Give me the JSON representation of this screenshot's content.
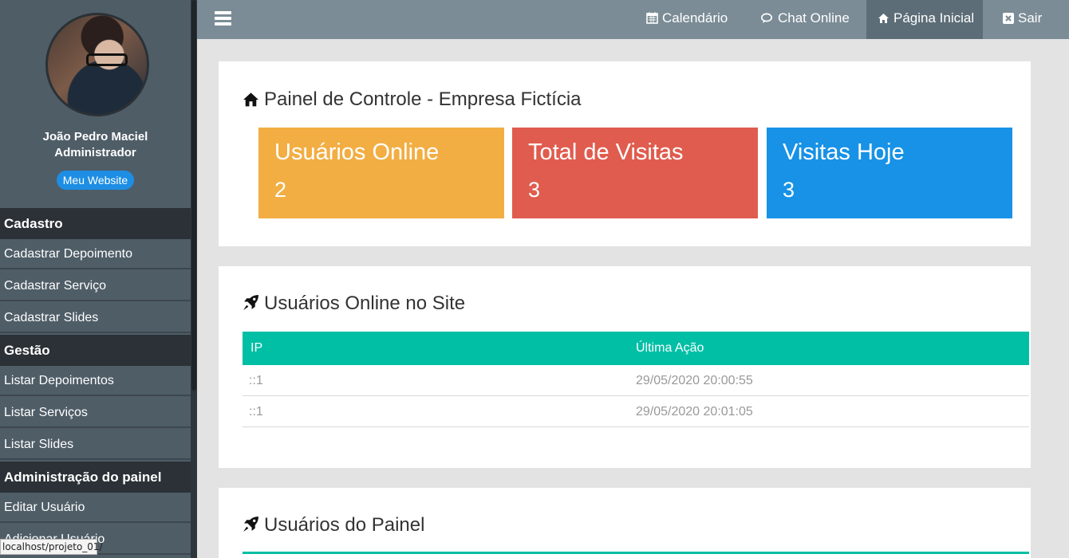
{
  "sidebar": {
    "user_name": "João Pedro Maciel",
    "user_role": "Administrador",
    "website_button": "Meu Website",
    "sections": [
      {
        "title": "Cadastro",
        "items": [
          "Cadastrar Depoimento",
          "Cadastrar Serviço",
          "Cadastrar Slides"
        ]
      },
      {
        "title": "Gestão",
        "items": [
          "Listar Depoimentos",
          "Listar Serviços",
          "Listar Slides"
        ]
      },
      {
        "title": "Administração do painel",
        "items": [
          "Editar Usuário",
          "Adicionar Usuário"
        ]
      }
    ]
  },
  "status_bar": {
    "url": "localhost/projeto_01/"
  },
  "topbar": {
    "menu_icon": "hamburger-icon",
    "nav": [
      {
        "label": "Calendário",
        "icon": "calendar-icon"
      },
      {
        "label": "Chat Online",
        "icon": "chat-icon"
      },
      {
        "label": "Página Inicial",
        "icon": "home-icon",
        "active": true
      },
      {
        "label": "Sair",
        "icon": "close-square-icon"
      }
    ]
  },
  "dashboard": {
    "title": "Painel de Controle - Empresa Fictícia",
    "title_icon": "home-icon",
    "stats": [
      {
        "label": "Usuários Online",
        "value": "2",
        "color": "#f2ae43"
      },
      {
        "label": "Total de Visitas",
        "value": "3",
        "color": "#e05c4e"
      },
      {
        "label": "Visitas Hoje",
        "value": "3",
        "color": "#1792e6"
      }
    ]
  },
  "online_users": {
    "title": "Usuários Online no Site",
    "title_icon": "rocket-icon",
    "columns": [
      "IP",
      "Última Ação"
    ],
    "rows": [
      [
        "::1",
        "29/05/2020 20:00:55"
      ],
      [
        "::1",
        "29/05/2020 20:01:05"
      ]
    ]
  },
  "panel_users": {
    "title": "Usuários do Painel",
    "title_icon": "rocket-icon"
  },
  "colors": {
    "sidebar_bg": "#4f5d67",
    "section_bg": "#2b3136",
    "topbar_bg": "#7b8c96",
    "topbar_active": "#5d6d77",
    "table_header": "#00bfa5",
    "website_button": "#1d8ee4"
  }
}
